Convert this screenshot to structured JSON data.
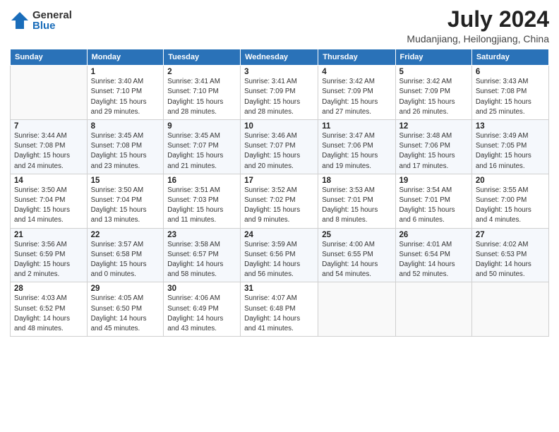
{
  "header": {
    "logo_general": "General",
    "logo_blue": "Blue",
    "title": "July 2024",
    "location": "Mudanjiang, Heilongjiang, China"
  },
  "days_of_week": [
    "Sunday",
    "Monday",
    "Tuesday",
    "Wednesday",
    "Thursday",
    "Friday",
    "Saturday"
  ],
  "weeks": [
    [
      {
        "day": "",
        "info": ""
      },
      {
        "day": "1",
        "info": "Sunrise: 3:40 AM\nSunset: 7:10 PM\nDaylight: 15 hours\nand 29 minutes."
      },
      {
        "day": "2",
        "info": "Sunrise: 3:41 AM\nSunset: 7:10 PM\nDaylight: 15 hours\nand 28 minutes."
      },
      {
        "day": "3",
        "info": "Sunrise: 3:41 AM\nSunset: 7:09 PM\nDaylight: 15 hours\nand 28 minutes."
      },
      {
        "day": "4",
        "info": "Sunrise: 3:42 AM\nSunset: 7:09 PM\nDaylight: 15 hours\nand 27 minutes."
      },
      {
        "day": "5",
        "info": "Sunrise: 3:42 AM\nSunset: 7:09 PM\nDaylight: 15 hours\nand 26 minutes."
      },
      {
        "day": "6",
        "info": "Sunrise: 3:43 AM\nSunset: 7:08 PM\nDaylight: 15 hours\nand 25 minutes."
      }
    ],
    [
      {
        "day": "7",
        "info": "Sunrise: 3:44 AM\nSunset: 7:08 PM\nDaylight: 15 hours\nand 24 minutes."
      },
      {
        "day": "8",
        "info": "Sunrise: 3:45 AM\nSunset: 7:08 PM\nDaylight: 15 hours\nand 23 minutes."
      },
      {
        "day": "9",
        "info": "Sunrise: 3:45 AM\nSunset: 7:07 PM\nDaylight: 15 hours\nand 21 minutes."
      },
      {
        "day": "10",
        "info": "Sunrise: 3:46 AM\nSunset: 7:07 PM\nDaylight: 15 hours\nand 20 minutes."
      },
      {
        "day": "11",
        "info": "Sunrise: 3:47 AM\nSunset: 7:06 PM\nDaylight: 15 hours\nand 19 minutes."
      },
      {
        "day": "12",
        "info": "Sunrise: 3:48 AM\nSunset: 7:06 PM\nDaylight: 15 hours\nand 17 minutes."
      },
      {
        "day": "13",
        "info": "Sunrise: 3:49 AM\nSunset: 7:05 PM\nDaylight: 15 hours\nand 16 minutes."
      }
    ],
    [
      {
        "day": "14",
        "info": "Sunrise: 3:50 AM\nSunset: 7:04 PM\nDaylight: 15 hours\nand 14 minutes."
      },
      {
        "day": "15",
        "info": "Sunrise: 3:50 AM\nSunset: 7:04 PM\nDaylight: 15 hours\nand 13 minutes."
      },
      {
        "day": "16",
        "info": "Sunrise: 3:51 AM\nSunset: 7:03 PM\nDaylight: 15 hours\nand 11 minutes."
      },
      {
        "day": "17",
        "info": "Sunrise: 3:52 AM\nSunset: 7:02 PM\nDaylight: 15 hours\nand 9 minutes."
      },
      {
        "day": "18",
        "info": "Sunrise: 3:53 AM\nSunset: 7:01 PM\nDaylight: 15 hours\nand 8 minutes."
      },
      {
        "day": "19",
        "info": "Sunrise: 3:54 AM\nSunset: 7:01 PM\nDaylight: 15 hours\nand 6 minutes."
      },
      {
        "day": "20",
        "info": "Sunrise: 3:55 AM\nSunset: 7:00 PM\nDaylight: 15 hours\nand 4 minutes."
      }
    ],
    [
      {
        "day": "21",
        "info": "Sunrise: 3:56 AM\nSunset: 6:59 PM\nDaylight: 15 hours\nand 2 minutes."
      },
      {
        "day": "22",
        "info": "Sunrise: 3:57 AM\nSunset: 6:58 PM\nDaylight: 15 hours\nand 0 minutes."
      },
      {
        "day": "23",
        "info": "Sunrise: 3:58 AM\nSunset: 6:57 PM\nDaylight: 14 hours\nand 58 minutes."
      },
      {
        "day": "24",
        "info": "Sunrise: 3:59 AM\nSunset: 6:56 PM\nDaylight: 14 hours\nand 56 minutes."
      },
      {
        "day": "25",
        "info": "Sunrise: 4:00 AM\nSunset: 6:55 PM\nDaylight: 14 hours\nand 54 minutes."
      },
      {
        "day": "26",
        "info": "Sunrise: 4:01 AM\nSunset: 6:54 PM\nDaylight: 14 hours\nand 52 minutes."
      },
      {
        "day": "27",
        "info": "Sunrise: 4:02 AM\nSunset: 6:53 PM\nDaylight: 14 hours\nand 50 minutes."
      }
    ],
    [
      {
        "day": "28",
        "info": "Sunrise: 4:03 AM\nSunset: 6:52 PM\nDaylight: 14 hours\nand 48 minutes."
      },
      {
        "day": "29",
        "info": "Sunrise: 4:05 AM\nSunset: 6:50 PM\nDaylight: 14 hours\nand 45 minutes."
      },
      {
        "day": "30",
        "info": "Sunrise: 4:06 AM\nSunset: 6:49 PM\nDaylight: 14 hours\nand 43 minutes."
      },
      {
        "day": "31",
        "info": "Sunrise: 4:07 AM\nSunset: 6:48 PM\nDaylight: 14 hours\nand 41 minutes."
      },
      {
        "day": "",
        "info": ""
      },
      {
        "day": "",
        "info": ""
      },
      {
        "day": "",
        "info": ""
      }
    ]
  ]
}
